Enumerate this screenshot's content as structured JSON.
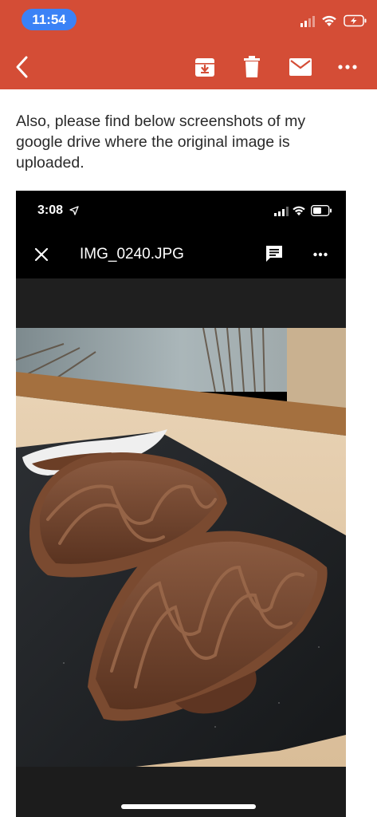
{
  "status_bar": {
    "time": "11:54"
  },
  "toolbar": {
    "back_icon": "chevron-left-icon",
    "archive_icon": "archive-icon",
    "delete_icon": "trash-icon",
    "mark_unread_icon": "mail-icon",
    "more_icon": "more-horizontal-icon"
  },
  "email": {
    "body_text": "Also, please find below screenshots of my google drive where the original image is uploaded."
  },
  "embedded_screenshot": {
    "time": "3:08",
    "filename": "IMG_0240.JPG",
    "close_icon": "close-icon",
    "comment_icon": "comment-icon",
    "more_icon": "more-horizontal-icon"
  },
  "colors": {
    "header": "#d44d36",
    "time_pill": "#3b82f6"
  }
}
